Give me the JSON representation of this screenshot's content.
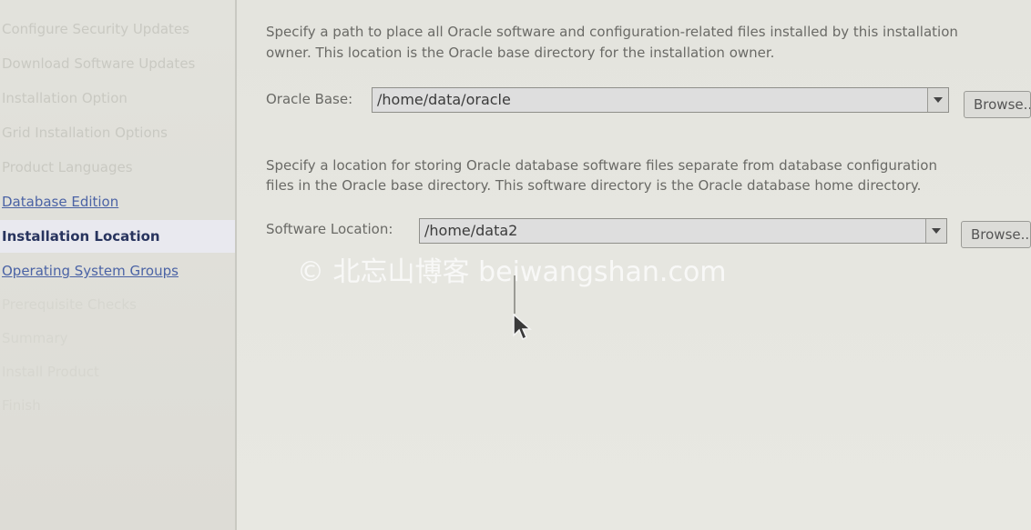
{
  "sidebar": {
    "steps": [
      {
        "label": "Configure Security Updates",
        "state": "done"
      },
      {
        "label": "Download Software Updates",
        "state": "done"
      },
      {
        "label": "Installation Option",
        "state": "done"
      },
      {
        "label": "Grid Installation Options",
        "state": "done"
      },
      {
        "label": "Product Languages",
        "state": "done"
      },
      {
        "label": "Database Edition",
        "state": "linked"
      },
      {
        "label": "Installation Location",
        "state": "current"
      },
      {
        "label": "Operating System Groups",
        "state": "linked"
      },
      {
        "label": "Prerequisite Checks",
        "state": "future"
      },
      {
        "label": "Summary",
        "state": "future"
      },
      {
        "label": "Install Product",
        "state": "future"
      },
      {
        "label": "Finish",
        "state": "future"
      }
    ]
  },
  "main": {
    "base_desc_line1": "Specify a path to place all Oracle software and configuration-related files installed by this installation",
    "base_desc_line2": "owner. This location is the Oracle base directory for the installation owner.",
    "oracle_base_label": "Oracle Base:",
    "oracle_base_value": "/home/data/oracle",
    "browse_label_1": "Browse...",
    "software_desc_line1": "Specify a location for storing Oracle database software files separate from database configuration",
    "software_desc_line2": "files in the Oracle base directory. This software directory is the Oracle database home directory.",
    "software_location_label": "Software Location:",
    "software_location_value": "/home/data2",
    "browse_label_2": "Browse..."
  },
  "watermark": "© 北忘山博客 beiwangshan.com",
  "icons": {
    "dropdown": "chevron-down-icon",
    "pointer": "mouse-pointer-icon"
  }
}
